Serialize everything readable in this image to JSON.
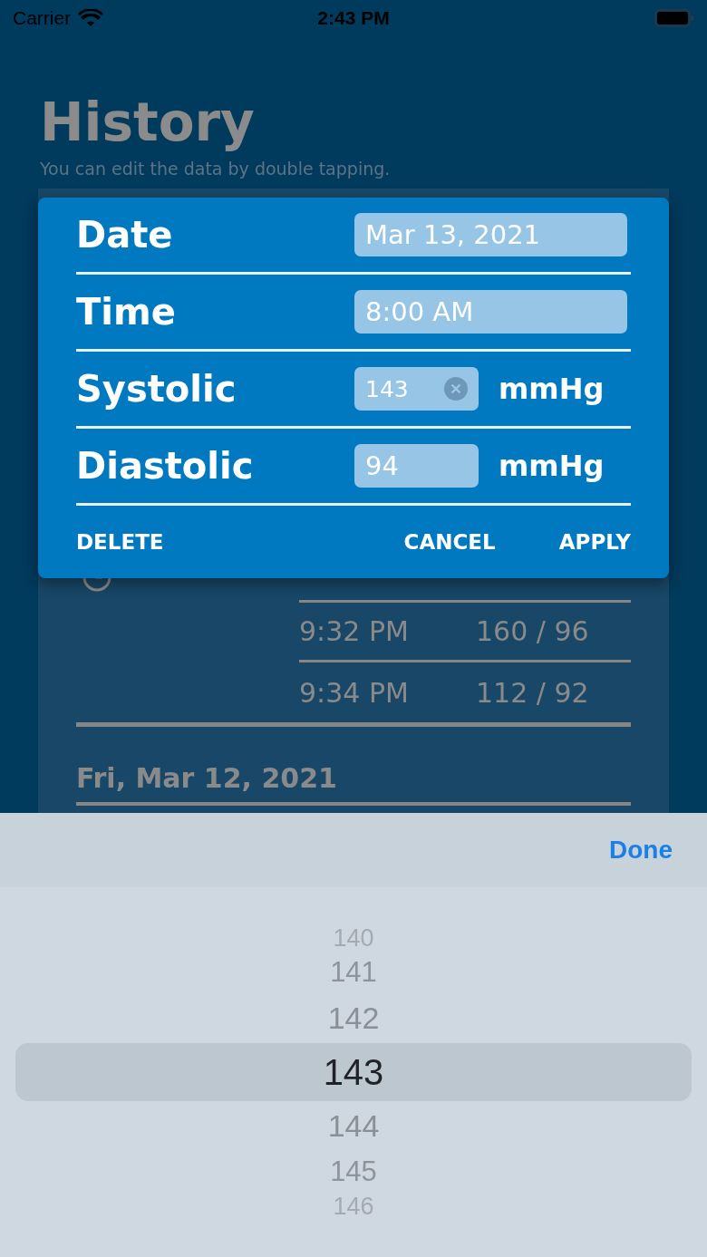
{
  "status_bar": {
    "carrier": "Carrier",
    "time": "2:43 PM"
  },
  "header": {
    "title": "History",
    "subtitle": "You can edit the data by double tapping."
  },
  "history": {
    "entries": [
      {
        "time": "9:32 PM",
        "reading": "160 / 96"
      },
      {
        "time": "9:34 PM",
        "reading": "112 / 92"
      }
    ],
    "next_date": "Fri, Mar 12, 2021"
  },
  "dialog": {
    "fields": [
      {
        "kind": "text",
        "label": "Date",
        "value": "Mar 13, 2021"
      },
      {
        "kind": "text",
        "label": "Time",
        "value": "8:00 AM"
      },
      {
        "kind": "number",
        "label": "Systolic",
        "value": "143",
        "unit": "mmHg",
        "focused": true
      },
      {
        "kind": "number",
        "label": "Diastolic",
        "value": "94",
        "unit": "mmHg",
        "focused": false
      }
    ],
    "actions": [
      "DELETE",
      "CANCEL",
      "APPLY"
    ]
  },
  "picker": {
    "done": "Done",
    "options": [
      {
        "value": "140",
        "selected": false
      },
      {
        "value": "141",
        "selected": false
      },
      {
        "value": "142",
        "selected": false
      },
      {
        "value": "143",
        "selected": true
      },
      {
        "value": "144",
        "selected": false
      },
      {
        "value": "145",
        "selected": false
      },
      {
        "value": "146",
        "selected": false
      }
    ]
  }
}
